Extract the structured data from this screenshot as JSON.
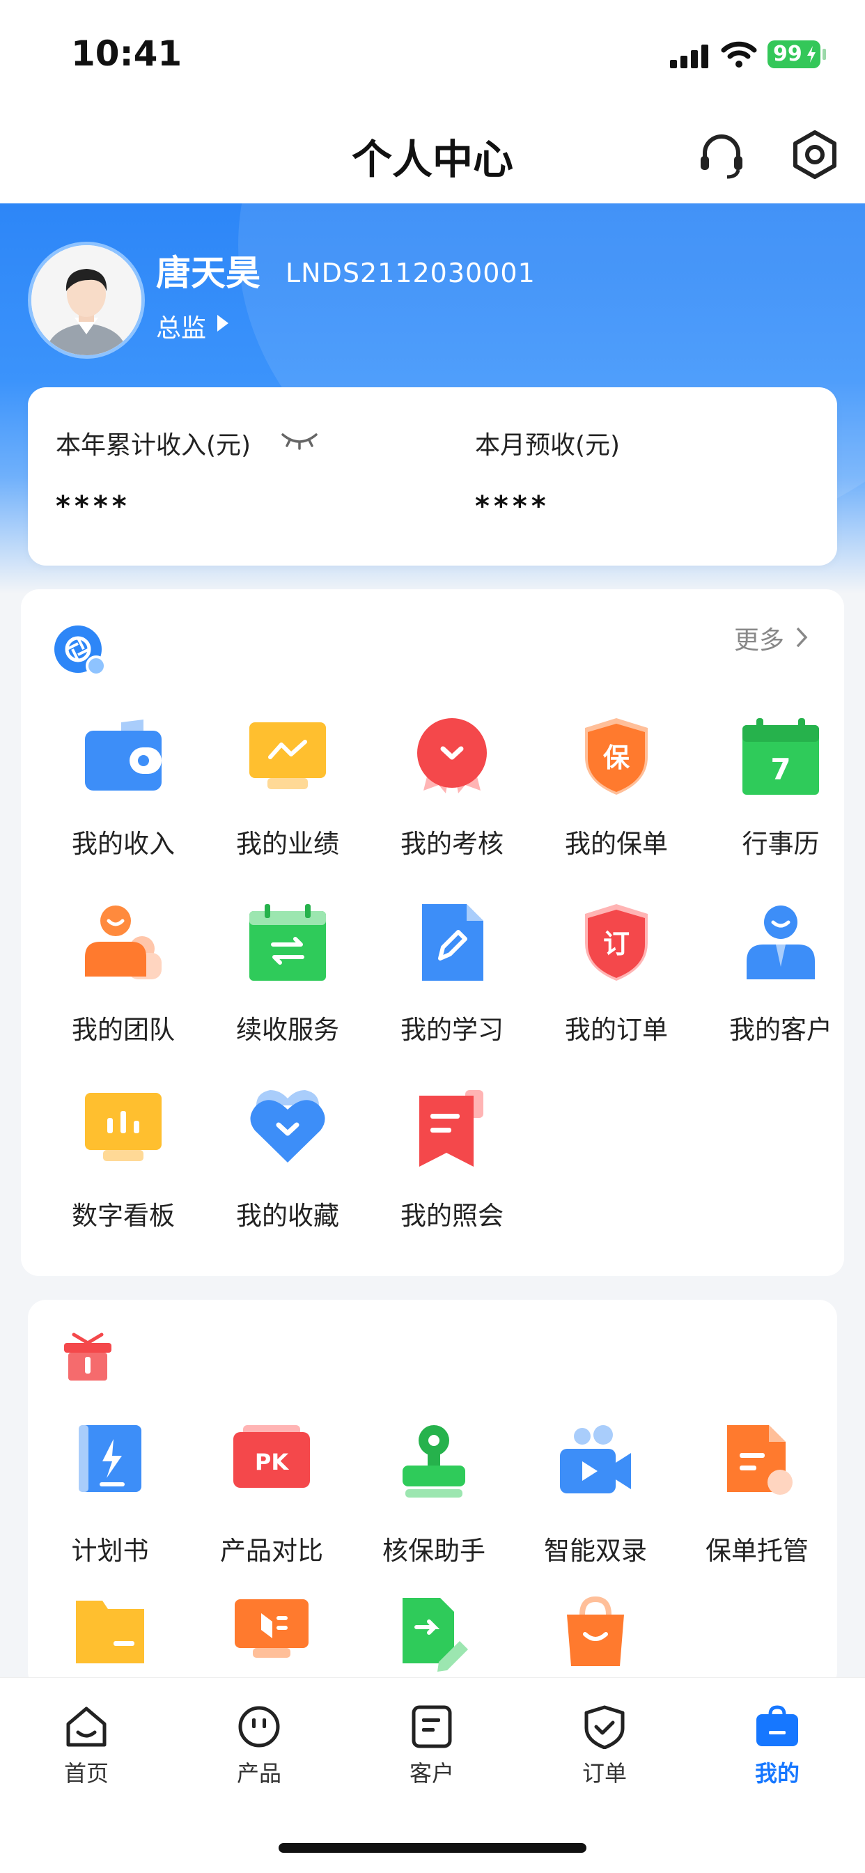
{
  "status": {
    "time": "10:41",
    "battery": "99"
  },
  "nav": {
    "title": "个人中心",
    "support_icon": "headset-icon",
    "settings_icon": "settings-gear-icon"
  },
  "profile": {
    "name": "唐天昊",
    "id": "LNDS2112030001",
    "role": "总监"
  },
  "income": {
    "year_label": "本年累计收入(元)",
    "year_value": "****",
    "month_label": "本月预收(元)",
    "month_value": "****"
  },
  "my_section": {
    "more": "更多",
    "items": [
      {
        "label": "我的收入",
        "icon": "wallet-icon"
      },
      {
        "label": "我的业绩",
        "icon": "performance-chart-icon"
      },
      {
        "label": "我的考核",
        "icon": "medal-icon"
      },
      {
        "label": "我的保单",
        "icon": "policy-shield-icon"
      },
      {
        "label": "行事历",
        "icon": "calendar-icon",
        "badge": "7"
      },
      {
        "label": "我的团队",
        "icon": "team-icon"
      },
      {
        "label": "续收服务",
        "icon": "renewal-icon"
      },
      {
        "label": "我的学习",
        "icon": "study-icon"
      },
      {
        "label": "我的订单",
        "icon": "order-icon"
      },
      {
        "label": "我的客户",
        "icon": "customer-icon"
      },
      {
        "label": "数字看板",
        "icon": "dashboard-icon"
      },
      {
        "label": "我的收藏",
        "icon": "favorite-heart-icon"
      },
      {
        "label": "我的照会",
        "icon": "notice-icon"
      }
    ]
  },
  "tools_section": {
    "items": [
      {
        "label": "计划书",
        "icon": "plan-book-icon"
      },
      {
        "label": "产品对比",
        "icon": "pk-compare-icon",
        "badge": "PK"
      },
      {
        "label": "核保助手",
        "icon": "underwriting-stamp-icon"
      },
      {
        "label": "智能双录",
        "icon": "video-record-icon"
      },
      {
        "label": "保单托管",
        "icon": "policy-custody-icon"
      },
      {
        "label": "",
        "icon": "folder-icon"
      },
      {
        "label": "",
        "icon": "presentation-icon"
      },
      {
        "label": "",
        "icon": "sign-document-icon"
      },
      {
        "label": "",
        "icon": "shopping-bag-icon"
      }
    ]
  },
  "tabbar": {
    "items": [
      {
        "label": "首页",
        "icon": "home-icon",
        "active": false
      },
      {
        "label": "产品",
        "icon": "product-icon",
        "active": false
      },
      {
        "label": "客户",
        "icon": "customer-doc-icon",
        "active": false
      },
      {
        "label": "订单",
        "icon": "order-shield-icon",
        "active": false
      },
      {
        "label": "我的",
        "icon": "profile-bag-icon",
        "active": true
      }
    ]
  },
  "colors": {
    "brand_blue": "#2d86f7",
    "active_tab": "#1677ff"
  }
}
